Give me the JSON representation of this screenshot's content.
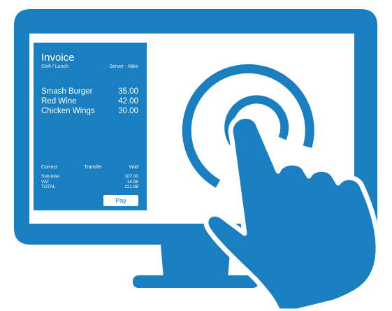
{
  "colors": {
    "accent": "#1a7fc0",
    "background": "#ffffff"
  },
  "icons": [
    "monitor-icon",
    "touch-ripple-icon",
    "pointing-hand-icon"
  ],
  "invoice": {
    "title": "Invoice",
    "shift": "Shift / Lunch",
    "server": "Server - Mike",
    "items": [
      {
        "name": "Smash Burger",
        "price": "35.00"
      },
      {
        "name": "Red Wine",
        "price": "42.00"
      },
      {
        "name": "Chicken Wings",
        "price": "30.00"
      }
    ],
    "actions": {
      "correct": "Correct",
      "transfer": "Transfer",
      "void": "Void"
    },
    "totals": [
      {
        "label": "Sub-total",
        "value": "107.00"
      },
      {
        "label": "VAT",
        "value": "14.98"
      },
      {
        "label": "TOTAL",
        "value": "121.98"
      }
    ],
    "pay_label": "Pay"
  }
}
